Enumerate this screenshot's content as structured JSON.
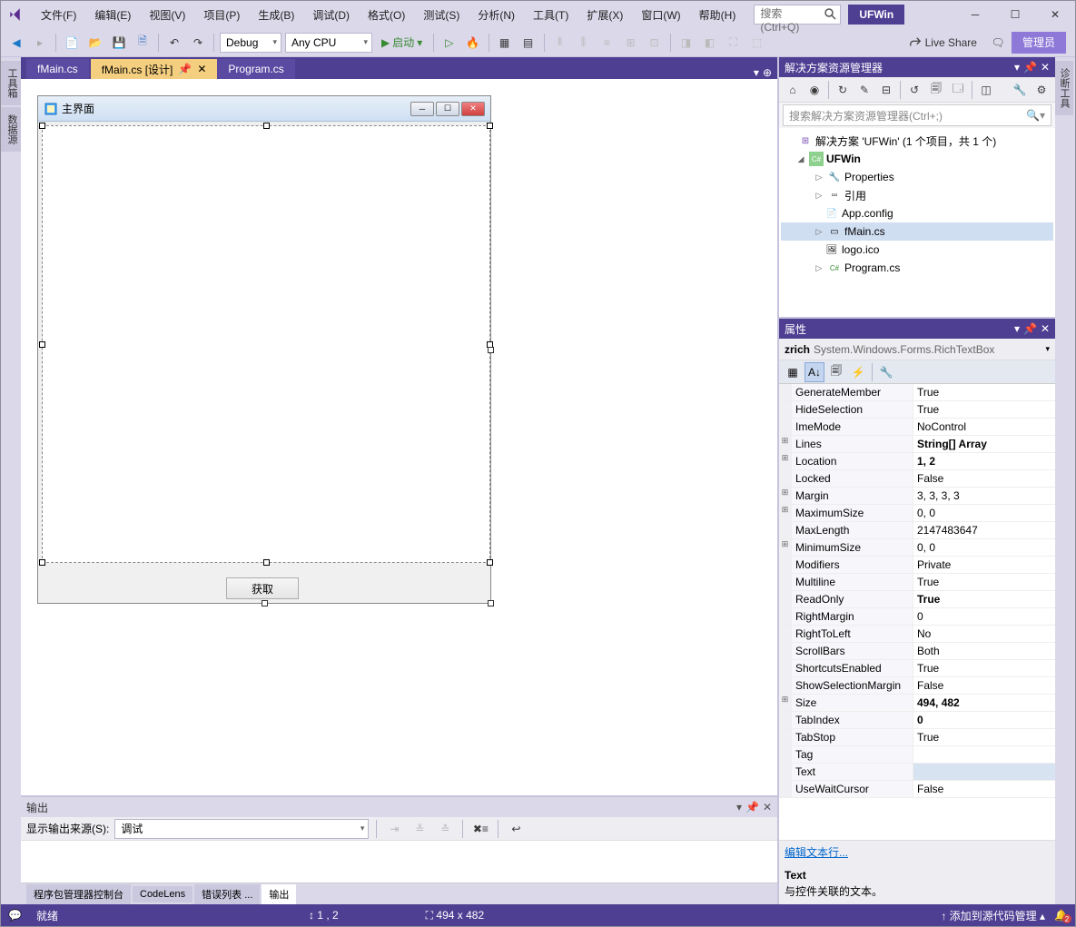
{
  "menu": [
    "文件(F)",
    "编辑(E)",
    "视图(V)",
    "项目(P)",
    "生成(B)",
    "调试(D)",
    "格式(O)",
    "测试(S)",
    "分析(N)",
    "工具(T)",
    "扩展(X)",
    "窗口(W)",
    "帮助(H)"
  ],
  "search_placeholder": "搜索 (Ctrl+Q)",
  "solution_name": "UFWin",
  "toolbar": {
    "config": "Debug",
    "platform": "Any CPU",
    "start": "启动",
    "live_share": "Live Share",
    "admin": "管理员"
  },
  "tabs": {
    "t1": "fMain.cs",
    "t2": "fMain.cs [设计]",
    "t3": "Program.cs"
  },
  "left_rail": {
    "toolbox": "工具箱",
    "datasource": "数据源"
  },
  "right_rail": {
    "diag": "诊断工具"
  },
  "form": {
    "title": "主界面",
    "button": "获取"
  },
  "output": {
    "title": "输出",
    "source_label": "显示输出来源(S):",
    "source": "调试"
  },
  "bottom_tabs": [
    "程序包管理器控制台",
    "CodeLens",
    "错误列表 ...",
    "输出"
  ],
  "solution_explorer": {
    "title": "解决方案资源管理器",
    "search": "搜索解决方案资源管理器(Ctrl+;)",
    "root": "解决方案 'UFWin' (1 个项目，共 1 个)",
    "project": "UFWin",
    "nodes": {
      "properties": "Properties",
      "references": "引用",
      "appconfig": "App.config",
      "fmain": "fMain.cs",
      "logo": "logo.ico",
      "program": "Program.cs"
    }
  },
  "properties_panel": {
    "title": "属性",
    "object_name": "zrich",
    "object_type": "System.Windows.Forms.RichTextBox",
    "rows": [
      {
        "exp": "",
        "name": "GenerateMember",
        "val": "True",
        "bold": false
      },
      {
        "exp": "",
        "name": "HideSelection",
        "val": "True",
        "bold": false
      },
      {
        "exp": "",
        "name": "ImeMode",
        "val": "NoControl",
        "bold": false
      },
      {
        "exp": "⊞",
        "name": "Lines",
        "val": "String[] Array",
        "bold": true
      },
      {
        "exp": "⊞",
        "name": "Location",
        "val": "1, 2",
        "bold": true
      },
      {
        "exp": "",
        "name": "Locked",
        "val": "False",
        "bold": false
      },
      {
        "exp": "⊞",
        "name": "Margin",
        "val": "3, 3, 3, 3",
        "bold": false
      },
      {
        "exp": "⊞",
        "name": "MaximumSize",
        "val": "0, 0",
        "bold": false
      },
      {
        "exp": "",
        "name": "MaxLength",
        "val": "2147483647",
        "bold": false
      },
      {
        "exp": "⊞",
        "name": "MinimumSize",
        "val": "0, 0",
        "bold": false
      },
      {
        "exp": "",
        "name": "Modifiers",
        "val": "Private",
        "bold": false
      },
      {
        "exp": "",
        "name": "Multiline",
        "val": "True",
        "bold": false
      },
      {
        "exp": "",
        "name": "ReadOnly",
        "val": "True",
        "bold": true
      },
      {
        "exp": "",
        "name": "RightMargin",
        "val": "0",
        "bold": false
      },
      {
        "exp": "",
        "name": "RightToLeft",
        "val": "No",
        "bold": false
      },
      {
        "exp": "",
        "name": "ScrollBars",
        "val": "Both",
        "bold": false
      },
      {
        "exp": "",
        "name": "ShortcutsEnabled",
        "val": "True",
        "bold": false
      },
      {
        "exp": "",
        "name": "ShowSelectionMargin",
        "val": "False",
        "bold": false
      },
      {
        "exp": "⊞",
        "name": "Size",
        "val": "494, 482",
        "bold": true
      },
      {
        "exp": "",
        "name": "TabIndex",
        "val": "0",
        "bold": true
      },
      {
        "exp": "",
        "name": "TabStop",
        "val": "True",
        "bold": false
      },
      {
        "exp": "",
        "name": "Tag",
        "val": "",
        "bold": false
      },
      {
        "exp": "",
        "name": "Text",
        "val": "",
        "bold": false,
        "sel": true
      },
      {
        "exp": "",
        "name": "UseWaitCursor",
        "val": "False",
        "bold": false
      }
    ],
    "link": "编辑文本行...",
    "desc_title": "Text",
    "desc": "与控件关联的文本。"
  },
  "status": {
    "ready": "就绪",
    "pos": "1 , 2",
    "size": "494 x 482",
    "add_source": "添加到源代码管理",
    "notif_count": "2"
  }
}
